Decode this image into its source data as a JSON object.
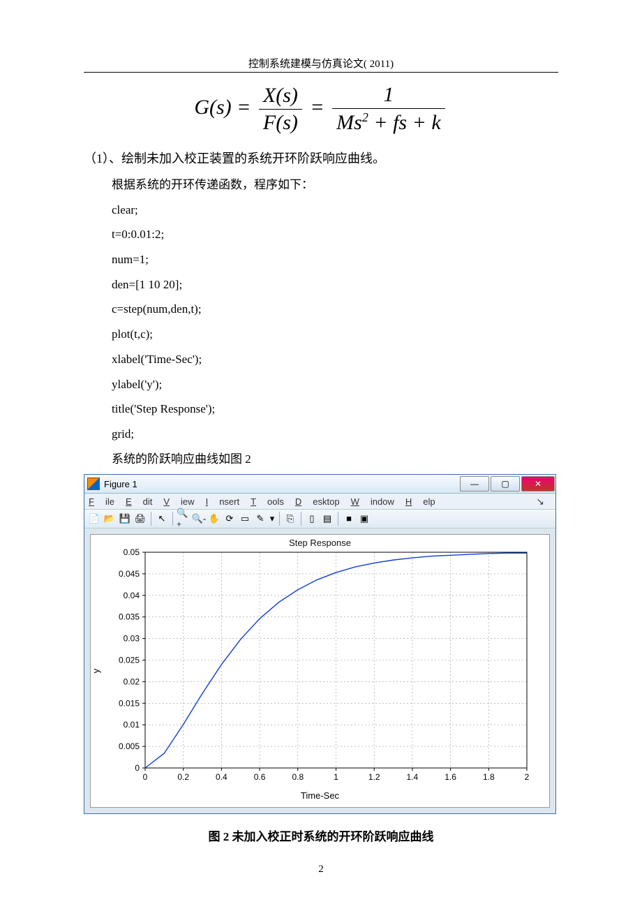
{
  "header": "控制系统建模与仿真论文( 2011)",
  "equation": {
    "lhs": "G(s)",
    "mid_num": "X(s)",
    "mid_den": "F(s)",
    "rhs_num": "1",
    "rhs_den": "Ms² + fs + k"
  },
  "section_label": "（1）、绘制未加入校正装置的系统开环阶跃响应曲线。",
  "intro_text": "根据系统的开环传递函数，程序如下：",
  "code_lines": [
    "clear;",
    "t=0:0.01:2;",
    "num=1;",
    "den=[1 10 20];",
    "c=step(num,den,t);",
    "plot(t,c);",
    "xlabel('Time-Sec');",
    "ylabel('y');",
    "title('Step Response');",
    "grid;"
  ],
  "after_code_text": "系统的阶跃响应曲线如图 2",
  "window": {
    "title": "Figure 1",
    "menus": [
      "File",
      "Edit",
      "View",
      "Insert",
      "Tools",
      "Desktop",
      "Window",
      "Help"
    ],
    "toolbar_icons": [
      "new-icon",
      "open-icon",
      "save-icon",
      "print-icon",
      "sep",
      "pointer-icon",
      "sep",
      "zoom-in-icon",
      "zoom-out-icon",
      "pan-icon",
      "rotate-icon",
      "data-cursor-icon",
      "brush-icon",
      "dropdown-icon",
      "sep",
      "link-icon",
      "sep",
      "colorbar-icon",
      "legend-icon",
      "sep",
      "hide-icon",
      "dock-icon"
    ]
  },
  "chart_data": {
    "type": "line",
    "title": "Step Response",
    "xlabel": "Time-Sec",
    "ylabel": "y",
    "xlim": [
      0,
      2
    ],
    "ylim": [
      0,
      0.05
    ],
    "xticks": [
      0,
      0.2,
      0.4,
      0.6,
      0.8,
      1,
      1.2,
      1.4,
      1.6,
      1.8,
      2
    ],
    "yticks": [
      0,
      0.005,
      0.01,
      0.015,
      0.02,
      0.025,
      0.03,
      0.035,
      0.04,
      0.045,
      0.05
    ],
    "x": [
      0,
      0.1,
      0.2,
      0.3,
      0.4,
      0.5,
      0.6,
      0.7,
      0.8,
      0.9,
      1.0,
      1.1,
      1.2,
      1.3,
      1.4,
      1.5,
      1.6,
      1.7,
      1.8,
      1.9,
      2.0
    ],
    "y": [
      0,
      0.0034,
      0.0101,
      0.0173,
      0.024,
      0.0298,
      0.0346,
      0.0384,
      0.0413,
      0.0436,
      0.0453,
      0.0466,
      0.0475,
      0.0482,
      0.0487,
      0.0491,
      0.0493,
      0.0495,
      0.0497,
      0.0498,
      0.0498
    ]
  },
  "figure_caption": "图 2  未加入校正时系统的开环阶跃响应曲线",
  "page_number": "2"
}
